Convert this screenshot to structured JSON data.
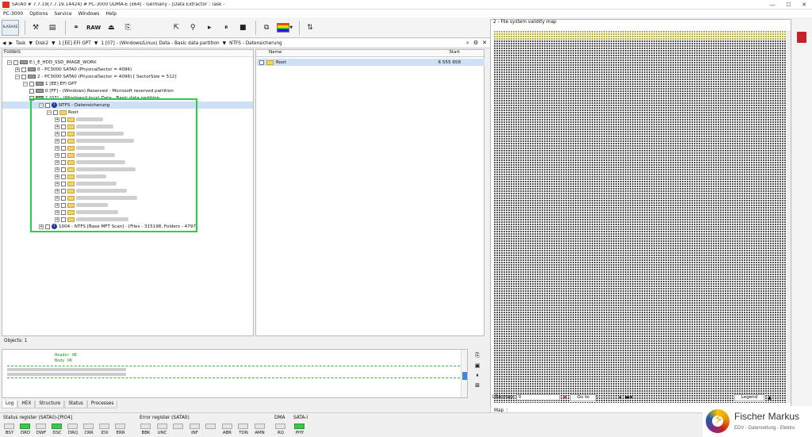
{
  "window": {
    "title": "SATA0 # 7.7.19(7.7.19.14424) # PC-3000 UDMA-E (x64) - Germany - [Data Extractor : Task - ",
    "minimize": "—",
    "maximize": "☐",
    "close": "✕"
  },
  "menu": {
    "items": [
      "PC-3000",
      "Options",
      "Service",
      "Windows",
      "Help"
    ]
  },
  "toolbar": {
    "logo_text": "ILASAAE",
    "raw_label": "RAW"
  },
  "nav": {
    "back": "◀",
    "forward": "▶",
    "dropdown": "▼",
    "crumbs": [
      "Task",
      "Disk2",
      "1 [EE] EFI GPT",
      "1 [07] - (Windows/Linux) Data - Basic data partition",
      "NTFS - Datensicherung"
    ]
  },
  "folders": {
    "header": "Folders",
    "rows": [
      {
        "label": "E:\\_E_HDD_SSD_IMAGE_WORK",
        "type": "drive"
      },
      {
        "label": "0 - PC3000 SATA0 (PhysicalSector = 4096)",
        "type": "drive"
      },
      {
        "label": "2 - PC3000 SATA0 (PhysicalSector = 4096) [ SectorSize = 512]",
        "type": "drive"
      },
      {
        "label": "1 [EE] EFI GPT",
        "type": "drive"
      },
      {
        "label": "0 [FF] - (Windows) Reserved - Microsoft reserved partition",
        "type": "drive"
      },
      {
        "label": "1 [07] - (Windows/Linux) Data - Basic data partition",
        "type": "drive"
      },
      {
        "label": "NTFS - Datensicherung",
        "type": "ntfs"
      },
      {
        "label": "Root",
        "type": "root"
      },
      {
        "label": "",
        "type": "folder"
      },
      {
        "label": "",
        "type": "folder"
      },
      {
        "label": "",
        "type": "folder"
      },
      {
        "label": "",
        "type": "folder"
      },
      {
        "label": "",
        "type": "folder"
      },
      {
        "label": "",
        "type": "folder"
      },
      {
        "label": "",
        "type": "folder"
      },
      {
        "label": "",
        "type": "folder"
      },
      {
        "label": "",
        "type": "folder"
      },
      {
        "label": "",
        "type": "folder"
      },
      {
        "label": "",
        "type": "folder"
      },
      {
        "label": "",
        "type": "folder"
      },
      {
        "label": "",
        "type": "folder"
      },
      {
        "label": "",
        "type": "folder"
      },
      {
        "label": "",
        "type": "folder"
      },
      {
        "label": "1004 - NTFS [Base MFT Scan] - [Files - 315198, Folders - 4797]",
        "type": "ntfs"
      }
    ]
  },
  "files": {
    "col_name": "Name",
    "col_start": "Start",
    "rows": [
      {
        "name": "Root",
        "start": "6 555 658"
      }
    ]
  },
  "objects_label": "Objects: 1",
  "log": {
    "lines": [
      "Header OK",
      "Body OK"
    ],
    "tabs": [
      "Log",
      "HEX",
      "Structure",
      "Status",
      "Processes"
    ]
  },
  "map": {
    "title": "2 - File system validity map",
    "lba_label": "LBA map",
    "lba_value": "0",
    "goto": "Go to",
    "legend": "Legend",
    "tab": "Map"
  },
  "status": {
    "register_title": "Status register (SATA0)-[PIO4]",
    "register_leds": [
      {
        "label": "BSY",
        "on": false
      },
      {
        "label": "DRD",
        "on": true
      },
      {
        "label": "DWF",
        "on": false
      },
      {
        "label": "DSC",
        "on": true
      },
      {
        "label": "DRQ",
        "on": false
      },
      {
        "label": "CRR",
        "on": false
      },
      {
        "label": "IDX",
        "on": false
      },
      {
        "label": "ERR",
        "on": false
      }
    ],
    "error_title": "Error register (SATA0)",
    "error_leds": [
      {
        "label": "BBK",
        "on": false
      },
      {
        "label": "UNC",
        "on": false
      },
      {
        "label": "",
        "on": false
      },
      {
        "label": "INF",
        "on": false
      },
      {
        "label": "",
        "on": false
      },
      {
        "label": "ABR",
        "on": false
      },
      {
        "label": "TON",
        "on": false
      },
      {
        "label": "AMN",
        "on": false
      }
    ],
    "dma_title": "DMA",
    "dma_led": "RQ",
    "sata_title": "SATA-I",
    "sata_led": "PHY"
  },
  "brand": {
    "name": "Fischer Markus",
    "tagline": "EDV - Datenrettung - Elektro"
  },
  "colors": {
    "highlight": "#26d14a",
    "led_on": "#39c84a",
    "selection": "#cde0f5",
    "map_used": "#b9b33a"
  }
}
